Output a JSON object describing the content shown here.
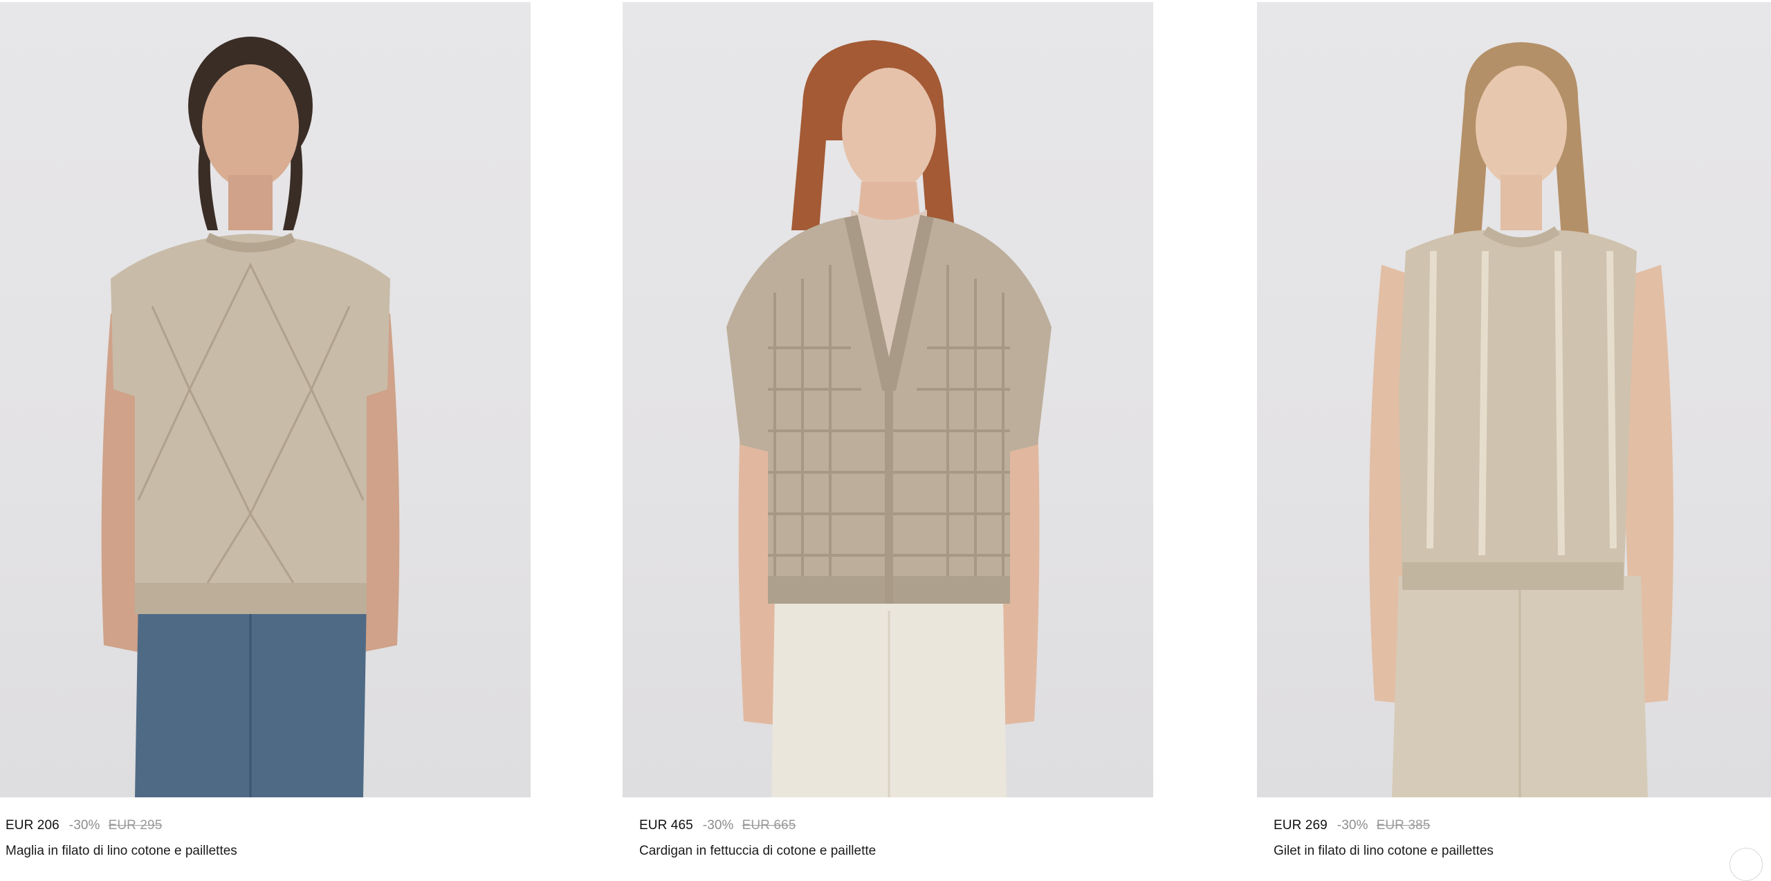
{
  "products": [
    {
      "price": "EUR 206",
      "discount": "-30%",
      "old_price": "EUR 295",
      "name": "Maglia in filato di lino cotone e paillettes"
    },
    {
      "price": "EUR 465",
      "discount": "-30%",
      "old_price": "EUR 665",
      "name": "Cardigan in fettuccia di cotone e paillette"
    },
    {
      "price": "EUR 269",
      "discount": "-30%",
      "old_price": "EUR 385",
      "name": "Gilet in filato di lino cotone e paillettes"
    }
  ],
  "colors": {
    "background": "#ffffff",
    "photo_bg": "#e5e4e6",
    "knit_beige": "#c8bba8",
    "denim": "#4f6a85",
    "cream_trousers": "#ebe6dc",
    "khaki_trousers": "#d6cbb8"
  }
}
